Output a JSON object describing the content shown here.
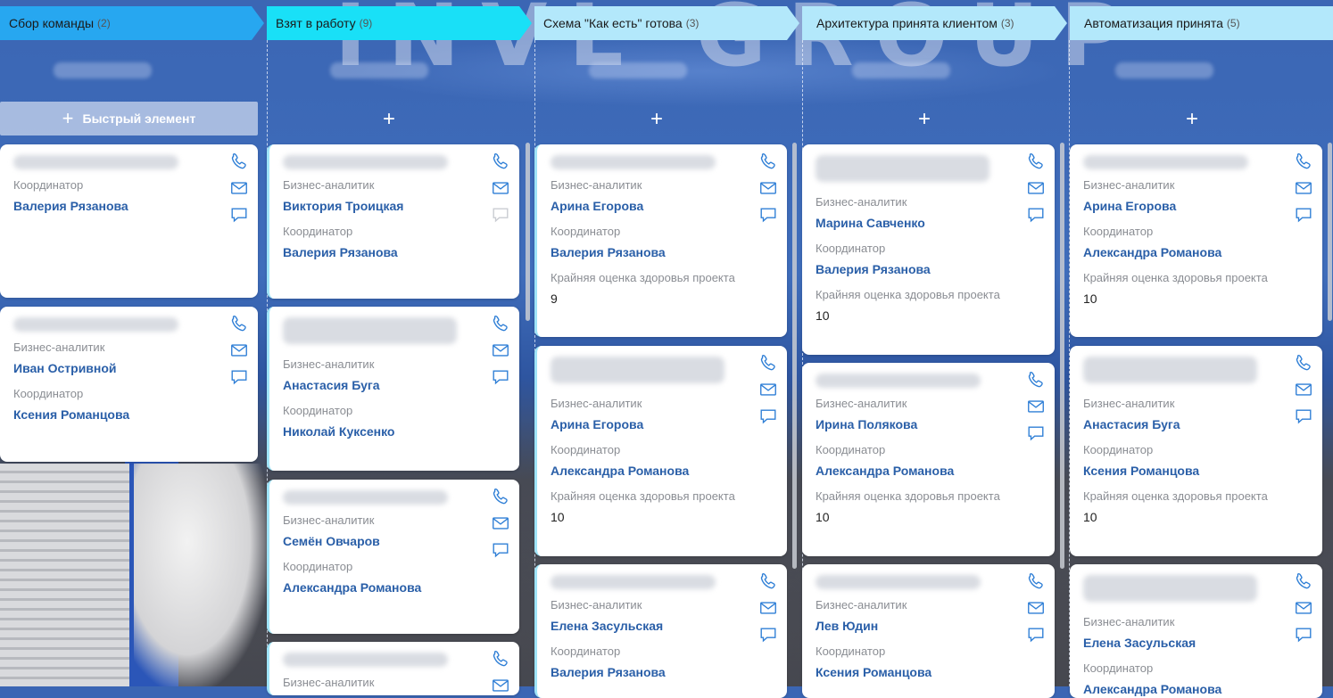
{
  "background": {
    "logo_text": "INVL GROUP",
    "colors": {
      "wall_blue": "#3f6dbb"
    }
  },
  "columns": [
    {
      "title": "Сбор команды",
      "count": "(2)",
      "header_color": "#27a7f0",
      "quick_add_label": "Быстрый элемент",
      "cards": [
        {
          "fields": [
            {
              "label": "Координатор",
              "value": "Валерия Рязанова"
            }
          ],
          "comment_active": true
        },
        {
          "fields": [
            {
              "label": "Бизнес-аналитик",
              "value": "Иван Остривной"
            },
            {
              "label": "Координатор",
              "value": "Ксения Романцова"
            }
          ],
          "comment_active": true
        }
      ]
    },
    {
      "title": "Взят в работу",
      "count": "(9)",
      "header_color": "#19e0f7",
      "add_label": "+",
      "cards": [
        {
          "fields": [
            {
              "label": "Бизнес-аналитик",
              "value": "Виктория Троицкая"
            },
            {
              "label": "Координатор",
              "value": "Валерия Рязанова"
            }
          ],
          "comment_active": false
        },
        {
          "fields": [
            {
              "label": "Бизнес-аналитик",
              "value": "Анастасия Буга"
            },
            {
              "label": "Координатор",
              "value": "Николай Куксенко"
            }
          ],
          "comment_active": true
        },
        {
          "fields": [
            {
              "label": "Бизнес-аналитик",
              "value": "Семён Овчаров"
            },
            {
              "label": "Координатор",
              "value": "Александра Романова"
            }
          ],
          "comment_active": true
        },
        {
          "fields": [
            {
              "label": "Бизнес-аналитик",
              "value": ""
            }
          ],
          "comment_active": true
        }
      ]
    },
    {
      "title": "Схема \"Как есть\" готова",
      "count": "(3)",
      "header_color": "#b3e8fb",
      "add_label": "+",
      "cards": [
        {
          "fields": [
            {
              "label": "Бизнес-аналитик",
              "value": "Арина Егорова"
            },
            {
              "label": "Координатор",
              "value": "Валерия Рязанова"
            },
            {
              "label": "Крайняя оценка здоровья проекта",
              "value": "9"
            }
          ],
          "comment_active": true
        },
        {
          "fields": [
            {
              "label": "Бизнес-аналитик",
              "value": "Арина Егорова"
            },
            {
              "label": "Координатор",
              "value": "Александра Романова"
            },
            {
              "label": "Крайняя оценка здоровья проекта",
              "value": "10"
            }
          ],
          "comment_active": true
        },
        {
          "fields": [
            {
              "label": "Бизнес-аналитик",
              "value": "Елена Засульская"
            },
            {
              "label": "Координатор",
              "value": "Валерия Рязанова"
            }
          ],
          "comment_active": true
        }
      ]
    },
    {
      "title": "Архитектура принята клиентом",
      "count": "(3)",
      "header_color": "#b3e8fb",
      "add_label": "+",
      "cards": [
        {
          "fields": [
            {
              "label": "Бизнес-аналитик",
              "value": "Марина Савченко"
            },
            {
              "label": "Координатор",
              "value": "Валерия Рязанова"
            },
            {
              "label": "Крайняя оценка здоровья проекта",
              "value": "10"
            }
          ],
          "comment_active": true
        },
        {
          "fields": [
            {
              "label": "Бизнес-аналитик",
              "value": "Ирина Полякова"
            },
            {
              "label": "Координатор",
              "value": "Александра Романова"
            },
            {
              "label": "Крайняя оценка здоровья проекта",
              "value": "10"
            }
          ],
          "comment_active": true
        },
        {
          "fields": [
            {
              "label": "Бизнес-аналитик",
              "value": "Лев Юдин"
            },
            {
              "label": "Координатор",
              "value": "Ксения Романцова"
            }
          ],
          "comment_active": true
        }
      ]
    },
    {
      "title": "Автоматизация принята",
      "count": "(5)",
      "header_color": "#b3e8fb",
      "add_label": "+",
      "cards": [
        {
          "fields": [
            {
              "label": "Бизнес-аналитик",
              "value": "Арина Егорова"
            },
            {
              "label": "Координатор",
              "value": "Александра Романова"
            },
            {
              "label": "Крайняя оценка здоровья проекта",
              "value": "10"
            }
          ],
          "comment_active": true
        },
        {
          "fields": [
            {
              "label": "Бизнес-аналитик",
              "value": "Анастасия Буга"
            },
            {
              "label": "Координатор",
              "value": "Ксения Романцова"
            },
            {
              "label": "Крайняя оценка здоровья проекта",
              "value": "10"
            }
          ],
          "comment_active": true
        },
        {
          "fields": [
            {
              "label": "Бизнес-аналитик",
              "value": "Елена Засульская"
            },
            {
              "label": "Координатор",
              "value": "Александра Романова"
            }
          ],
          "comment_active": true
        }
      ]
    }
  ],
  "icons": {
    "phone": "phone-icon",
    "mail": "mail-icon",
    "comment": "comment-icon"
  },
  "colors": {
    "icon_active": "#2f7fd6",
    "icon_inactive": "#c9ccd2",
    "value_text": "#2a5fa8",
    "label_text": "#8a8d93",
    "card_accent": "#9fe4f8"
  }
}
